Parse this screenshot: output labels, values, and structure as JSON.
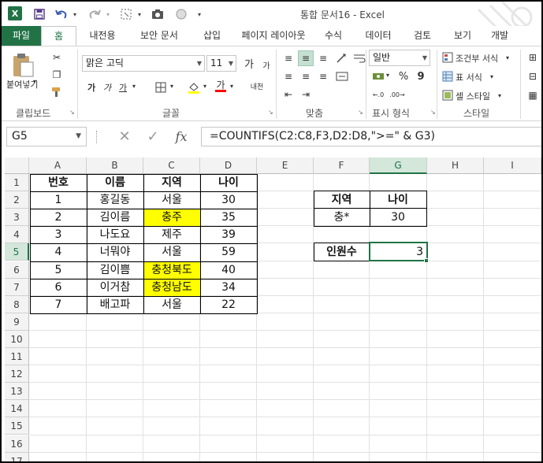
{
  "window": {
    "app_logo": "X",
    "title": "통합 문서16 - Excel"
  },
  "quick_access": [
    "save-icon",
    "undo-icon",
    "redo-icon",
    "camera-icon",
    "circle-icon"
  ],
  "tabs": [
    {
      "label": "파일"
    },
    {
      "label": "홈"
    },
    {
      "label": "내전용"
    },
    {
      "label": "보안 문서"
    },
    {
      "label": "삽입"
    },
    {
      "label": "페이지 레이아웃"
    },
    {
      "label": "수식"
    },
    {
      "label": "데이터"
    },
    {
      "label": "검토"
    },
    {
      "label": "보기"
    },
    {
      "label": "개발"
    }
  ],
  "ribbon": {
    "clipboard": {
      "paste": "붙여넣기",
      "label": "클립보드"
    },
    "font": {
      "name": "맑은 고딕",
      "size": "11",
      "grow": "가",
      "shrink": "가",
      "bold": "가",
      "italic": "가",
      "underline": "가",
      "color_a": "가",
      "label": "글꼴",
      "phonetic": "내천"
    },
    "alignment": {
      "label": "맞춤"
    },
    "number": {
      "format": "일반",
      "percent": "%",
      "comma": "9",
      "label": "표시 형식"
    },
    "styles": {
      "conditional": "조건부 서식",
      "table": "표 서식",
      "cell": "셀 스타일",
      "label": "스타일"
    }
  },
  "formula_bar": {
    "name_box": "G5",
    "fx": "fx",
    "formula": "=COUNTIFS(C2:C8,F3,D2:D8,\">=\" & G3)"
  },
  "columns": [
    "A",
    "B",
    "C",
    "D",
    "E",
    "F",
    "G",
    "H",
    "I"
  ],
  "rows": [
    "1",
    "2",
    "3",
    "4",
    "5",
    "6",
    "7",
    "8",
    "9",
    "10",
    "11",
    "12",
    "13",
    "14",
    "15",
    "16",
    "17"
  ],
  "table": {
    "headers": [
      "번호",
      "이름",
      "지역",
      "나이"
    ],
    "rows": [
      {
        "no": "1",
        "name": "홍길동",
        "region": "서울",
        "age": "30",
        "highlight": false
      },
      {
        "no": "2",
        "name": "김이름",
        "region": "충주",
        "age": "35",
        "highlight": true
      },
      {
        "no": "3",
        "name": "나도요",
        "region": "제주",
        "age": "39",
        "highlight": false
      },
      {
        "no": "4",
        "name": "너뭐야",
        "region": "서울",
        "age": "59",
        "highlight": false
      },
      {
        "no": "5",
        "name": "김이쁨",
        "region": "충청북도",
        "age": "40",
        "highlight": true
      },
      {
        "no": "6",
        "name": "이거참",
        "region": "충청남도",
        "age": "34",
        "highlight": true
      },
      {
        "no": "7",
        "name": "배고파",
        "region": "서울",
        "age": "22",
        "highlight": false
      }
    ]
  },
  "criteria": {
    "header_region": "지역",
    "header_age": "나이",
    "region": "충*",
    "age": "30",
    "count_label": "인원수",
    "count_value": "3"
  },
  "colors": {
    "excel_green": "#217346",
    "highlight": "#ffff00"
  }
}
